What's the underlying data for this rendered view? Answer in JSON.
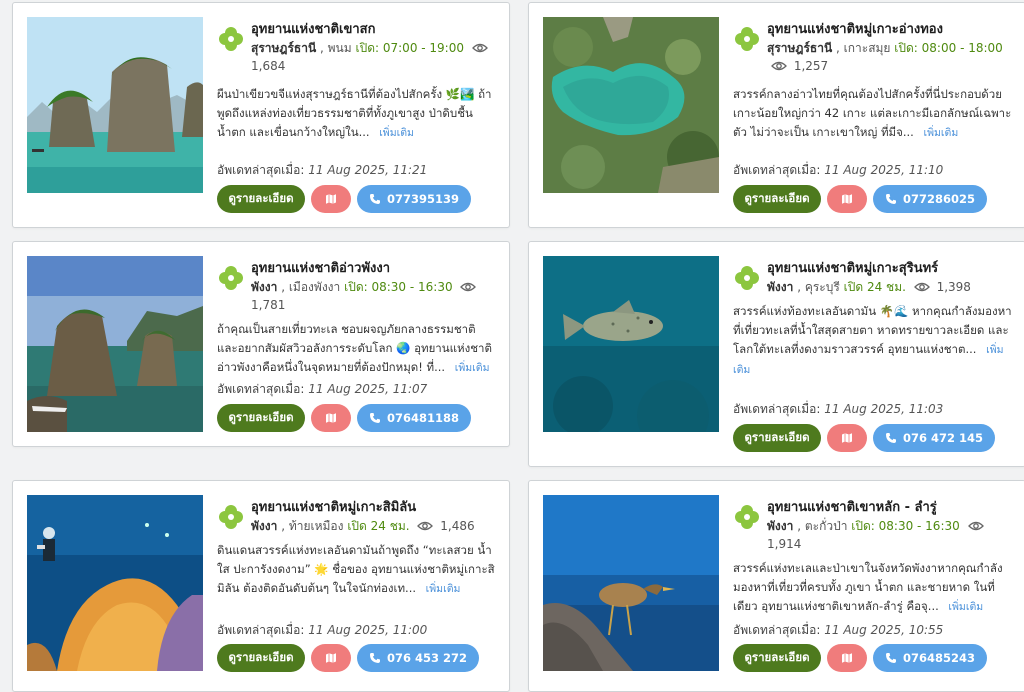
{
  "common": {
    "updated_label": "อัพเดทล่าสุดเมื่อ:",
    "detail_label": "ดูรายละเอียด",
    "more_label": "เพิ่มเติม",
    "open_prefix": "เปิด:",
    "colors": {
      "detail": "#4e7a1e",
      "map": "#f07c7c",
      "phone": "#5aa3e8",
      "open": "#4f8a10"
    }
  },
  "cards": [
    {
      "title": "อุทยานแห่งชาติเขาสก",
      "province": "สุราษฎร์ธานี",
      "district": ", พนม",
      "hours": "เปิด: 07:00 - 19:00",
      "views": "1,684",
      "desc": "ผืนป่าเขียวขจีแห่งสุราษฎร์ธานีที่ต้องไปสักครั้ง 🌿🏞️ ถ้าพูดถึงแหล่งท่องเที่ยวธรรมชาติที่ทั้งภูเขาสูง ป่าดิบชื้น น้ำตก และเขื่อนกว้างใหญ่ใน...",
      "updated": "11 Aug 2025, 11:21",
      "phone": "077395139"
    },
    {
      "title": "อุทยานแห่งชาติหมู่เกาะอ่างทอง",
      "province": "สุราษฎร์ธานี",
      "district": ", เกาะสมุย",
      "hours": "เปิด: 08:00 - 18:00",
      "views": "1,257",
      "desc": "สวรรค์กลางอ่าวไทยที่คุณต้องไปสักครั้งที่นี่ประกอบด้วยเกาะน้อยใหญ่กว่า 42 เกาะ แต่ละเกาะมีเอกลักษณ์เฉพาะตัว ไม่ว่าจะเป็น เกาะเขาใหญ่ ที่มีจ...",
      "updated": "11 Aug 2025, 11:10",
      "phone": "077286025"
    },
    {
      "title": "อุทยานแห่งชาติอ่าวพังงา",
      "province": "พังงา",
      "district": ", เมืองพังงา",
      "hours": "เปิด: 08:30 - 16:30",
      "views": "1,781",
      "desc": "ถ้าคุณเป็นสายเที่ยวทะเล ชอบผจญภัยกลางธรรมชาติ และอยากสัมผัสวิวอลังการระดับโลก 🌏 อุทยานแห่งชาติอ่าวพังงาคือหนึ่งในจุดหมายที่ต้องปักหมุด! ที่...",
      "updated": "11 Aug 2025, 11:07",
      "phone": "076481188"
    },
    {
      "title": "อุทยานแห่งชาติหมู่เกาะสุรินทร์",
      "province": "พังงา",
      "district": ", คุระบุรี",
      "hours": "เปิด 24 ชม.",
      "views": "1,398",
      "desc": "สวรรค์แห่งท้องทะเลอันดามัน 🌴🌊 หากคุณกำลังมองหาที่เที่ยวทะเลที่น้ำใสสุดสายตา หาดทรายขาวละเอียด และโลกใต้ทะเลที่งดงามราวสวรรค์ อุทยานแห่งชาต...",
      "updated": "11 Aug 2025, 11:03",
      "phone": "076 472 145"
    },
    {
      "title": "อุทยานแห่งชาติหมู่เกาะสิมิลัน",
      "province": "พังงา",
      "district": ", ท้ายเหมือง",
      "hours": "เปิด 24 ชม.",
      "views": "1,486",
      "desc": "ดินแดนสวรรค์แห่งทะเลอันดามันถ้าพูดถึง “ทะเลสวย น้ำใส ปะการังงดงาม” 🌟 ชื่อของ อุทยานแห่งชาติหมู่เกาะสิมิลัน ต้องติดอันดับต้นๆ ในใจนักท่องเท...",
      "updated": "11 Aug 2025, 11:00",
      "phone": "076 453 272"
    },
    {
      "title": "อุทยานแห่งชาติเขาหลัก - ลำรู่",
      "province": "พังงา",
      "district": ", ตะกั่วป่า",
      "hours": "เปิด: 08:30 - 16:30",
      "views": "1,914",
      "desc": "สวรรค์แห่งทะเลและป่าเขาในจังหวัดพังงาหากคุณกำลังมองหาที่เที่ยวที่ครบทั้ง ภูเขา น้ำตก และชายหาด ในที่เดียว อุทยานแห่งชาติเขาหลัก-ลำรู่ คือจุ...",
      "updated": "11 Aug 2025, 10:55",
      "phone": "076485243"
    }
  ]
}
